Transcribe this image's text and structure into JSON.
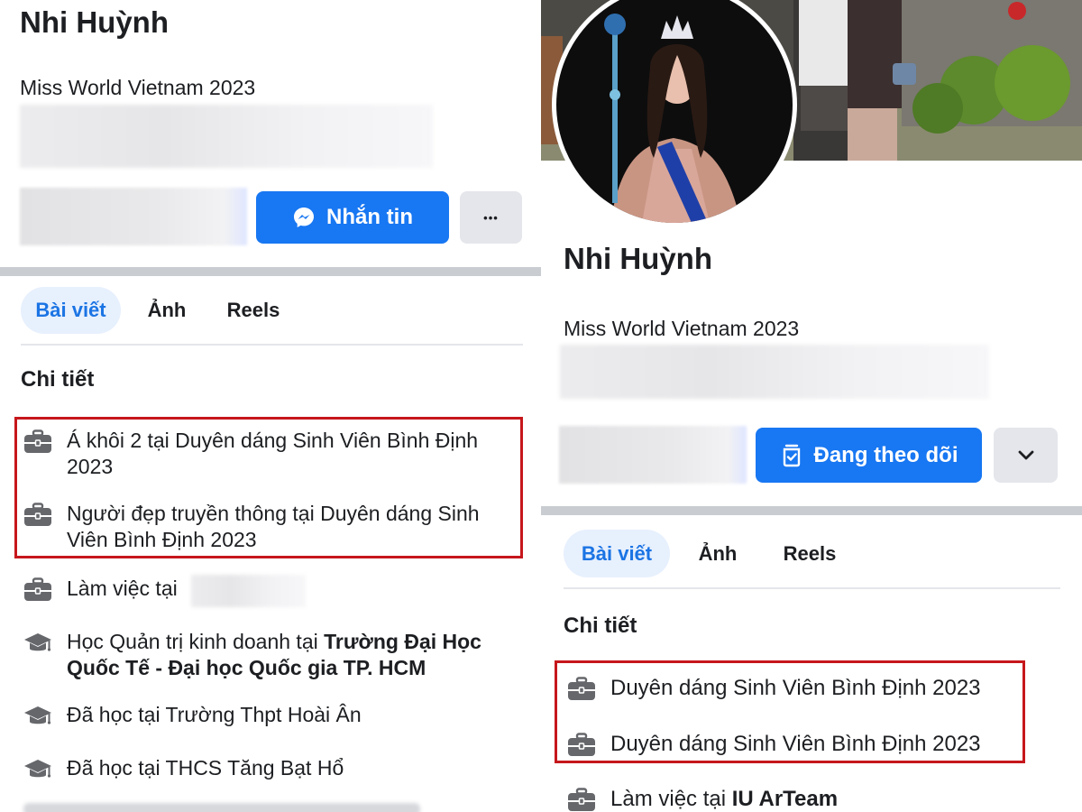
{
  "left": {
    "name": "Nhi Huỳnh",
    "bio": "Miss World Vietnam 2023",
    "message_button": "Nhắn tin",
    "more_button": "•••",
    "tabs": [
      "Bài viết",
      "Ảnh",
      "Reels"
    ],
    "details_title": "Chi tiết",
    "details": [
      {
        "icon": "briefcase-icon",
        "text": "Á khôi 2 tại Duyên dáng Sinh Viên Bình Định 2023"
      },
      {
        "icon": "briefcase-icon",
        "text": "Người đẹp truyền thông tại Duyên dáng Sinh Viên Bình Định 2023"
      },
      {
        "icon": "briefcase-icon",
        "text": "Làm việc tại"
      },
      {
        "icon": "graduation-cap-icon",
        "prefix": "Học Quản trị kinh doanh tại ",
        "bold": "Trường Đại Học Quốc Tế - Đại học Quốc gia TP. HCM"
      },
      {
        "icon": "graduation-cap-icon",
        "text": "Đã học tại Trường Thpt Hoài Ân"
      },
      {
        "icon": "graduation-cap-icon",
        "text": "Đã học tại THCS Tăng Bạt Hổ"
      }
    ]
  },
  "right": {
    "name": "Nhi Huỳnh",
    "bio": "Miss World Vietnam 2023",
    "following_button": "Đang theo dõi",
    "tabs": [
      "Bài viết",
      "Ảnh",
      "Reels"
    ],
    "details_title": "Chi tiết",
    "details": [
      {
        "icon": "briefcase-icon",
        "text": "Duyên dáng Sinh Viên Bình Định 2023"
      },
      {
        "icon": "briefcase-icon",
        "text": "Duyên dáng Sinh Viên Bình Định 2023"
      },
      {
        "icon": "briefcase-icon",
        "prefix": "Làm việc tại ",
        "bold": "IU ArTeam"
      }
    ]
  },
  "colors": {
    "accent": "#1877f2",
    "highlight_box": "#c6171c",
    "active_tab_bg": "#e7f0fd",
    "divider": "#c9ccd1"
  }
}
